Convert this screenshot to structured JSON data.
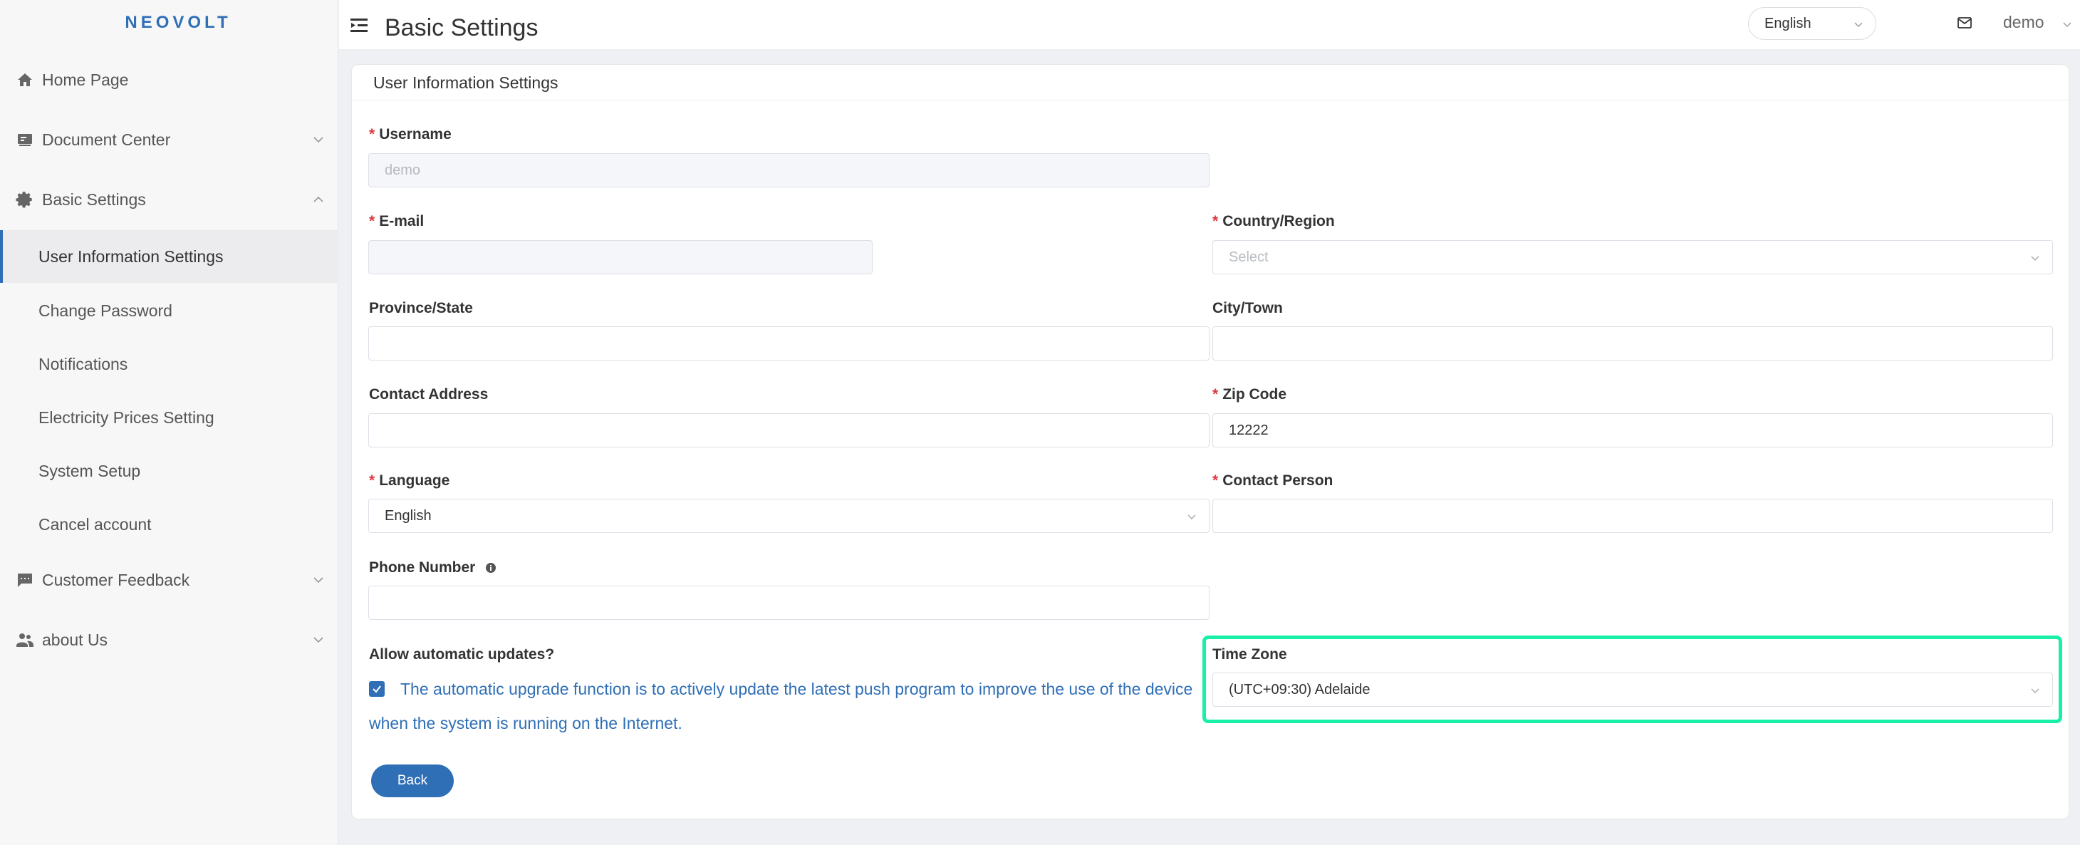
{
  "sidebar": {
    "logo": "NEOVOLT",
    "items": [
      {
        "label": "Home Page"
      },
      {
        "label": "Document Center"
      },
      {
        "label": "Basic Settings"
      },
      {
        "label": "Customer Feedback"
      },
      {
        "label": "about Us"
      }
    ],
    "subitems": [
      {
        "label": "User Information Settings"
      },
      {
        "label": "Change Password"
      },
      {
        "label": "Notifications"
      },
      {
        "label": "Electricity Prices Setting"
      },
      {
        "label": "System Setup"
      },
      {
        "label": "Cancel account"
      }
    ]
  },
  "header": {
    "title": "Basic Settings",
    "language": "English",
    "user": "demo"
  },
  "card": {
    "title": "User Information Settings"
  },
  "form": {
    "username": {
      "label": "Username",
      "value": "demo"
    },
    "email": {
      "label": "E-mail",
      "value": ""
    },
    "country": {
      "label": "Country/Region",
      "placeholder": "Select"
    },
    "province": {
      "label": "Province/State",
      "value": ""
    },
    "city": {
      "label": "City/Town",
      "value": ""
    },
    "address": {
      "label": "Contact Address",
      "value": ""
    },
    "zip": {
      "label": "Zip Code",
      "value": "12222"
    },
    "language": {
      "label": "Language",
      "value": "English"
    },
    "contact_person": {
      "label": "Contact Person",
      "value": ""
    },
    "phone": {
      "label": "Phone Number",
      "value": ""
    },
    "auto_updates": {
      "label": "Allow automatic updates?",
      "text": "The automatic upgrade function is to actively update the latest push program to improve the use of the device when the system is running on the Internet.",
      "checked": true
    },
    "timezone": {
      "label": "Time Zone",
      "value": "(UTC+09:30) Adelaide"
    },
    "back_label": "Back"
  },
  "colors": {
    "accent": "#2f6fb6",
    "required": "#e0383e",
    "highlight": "#19f0a6"
  }
}
